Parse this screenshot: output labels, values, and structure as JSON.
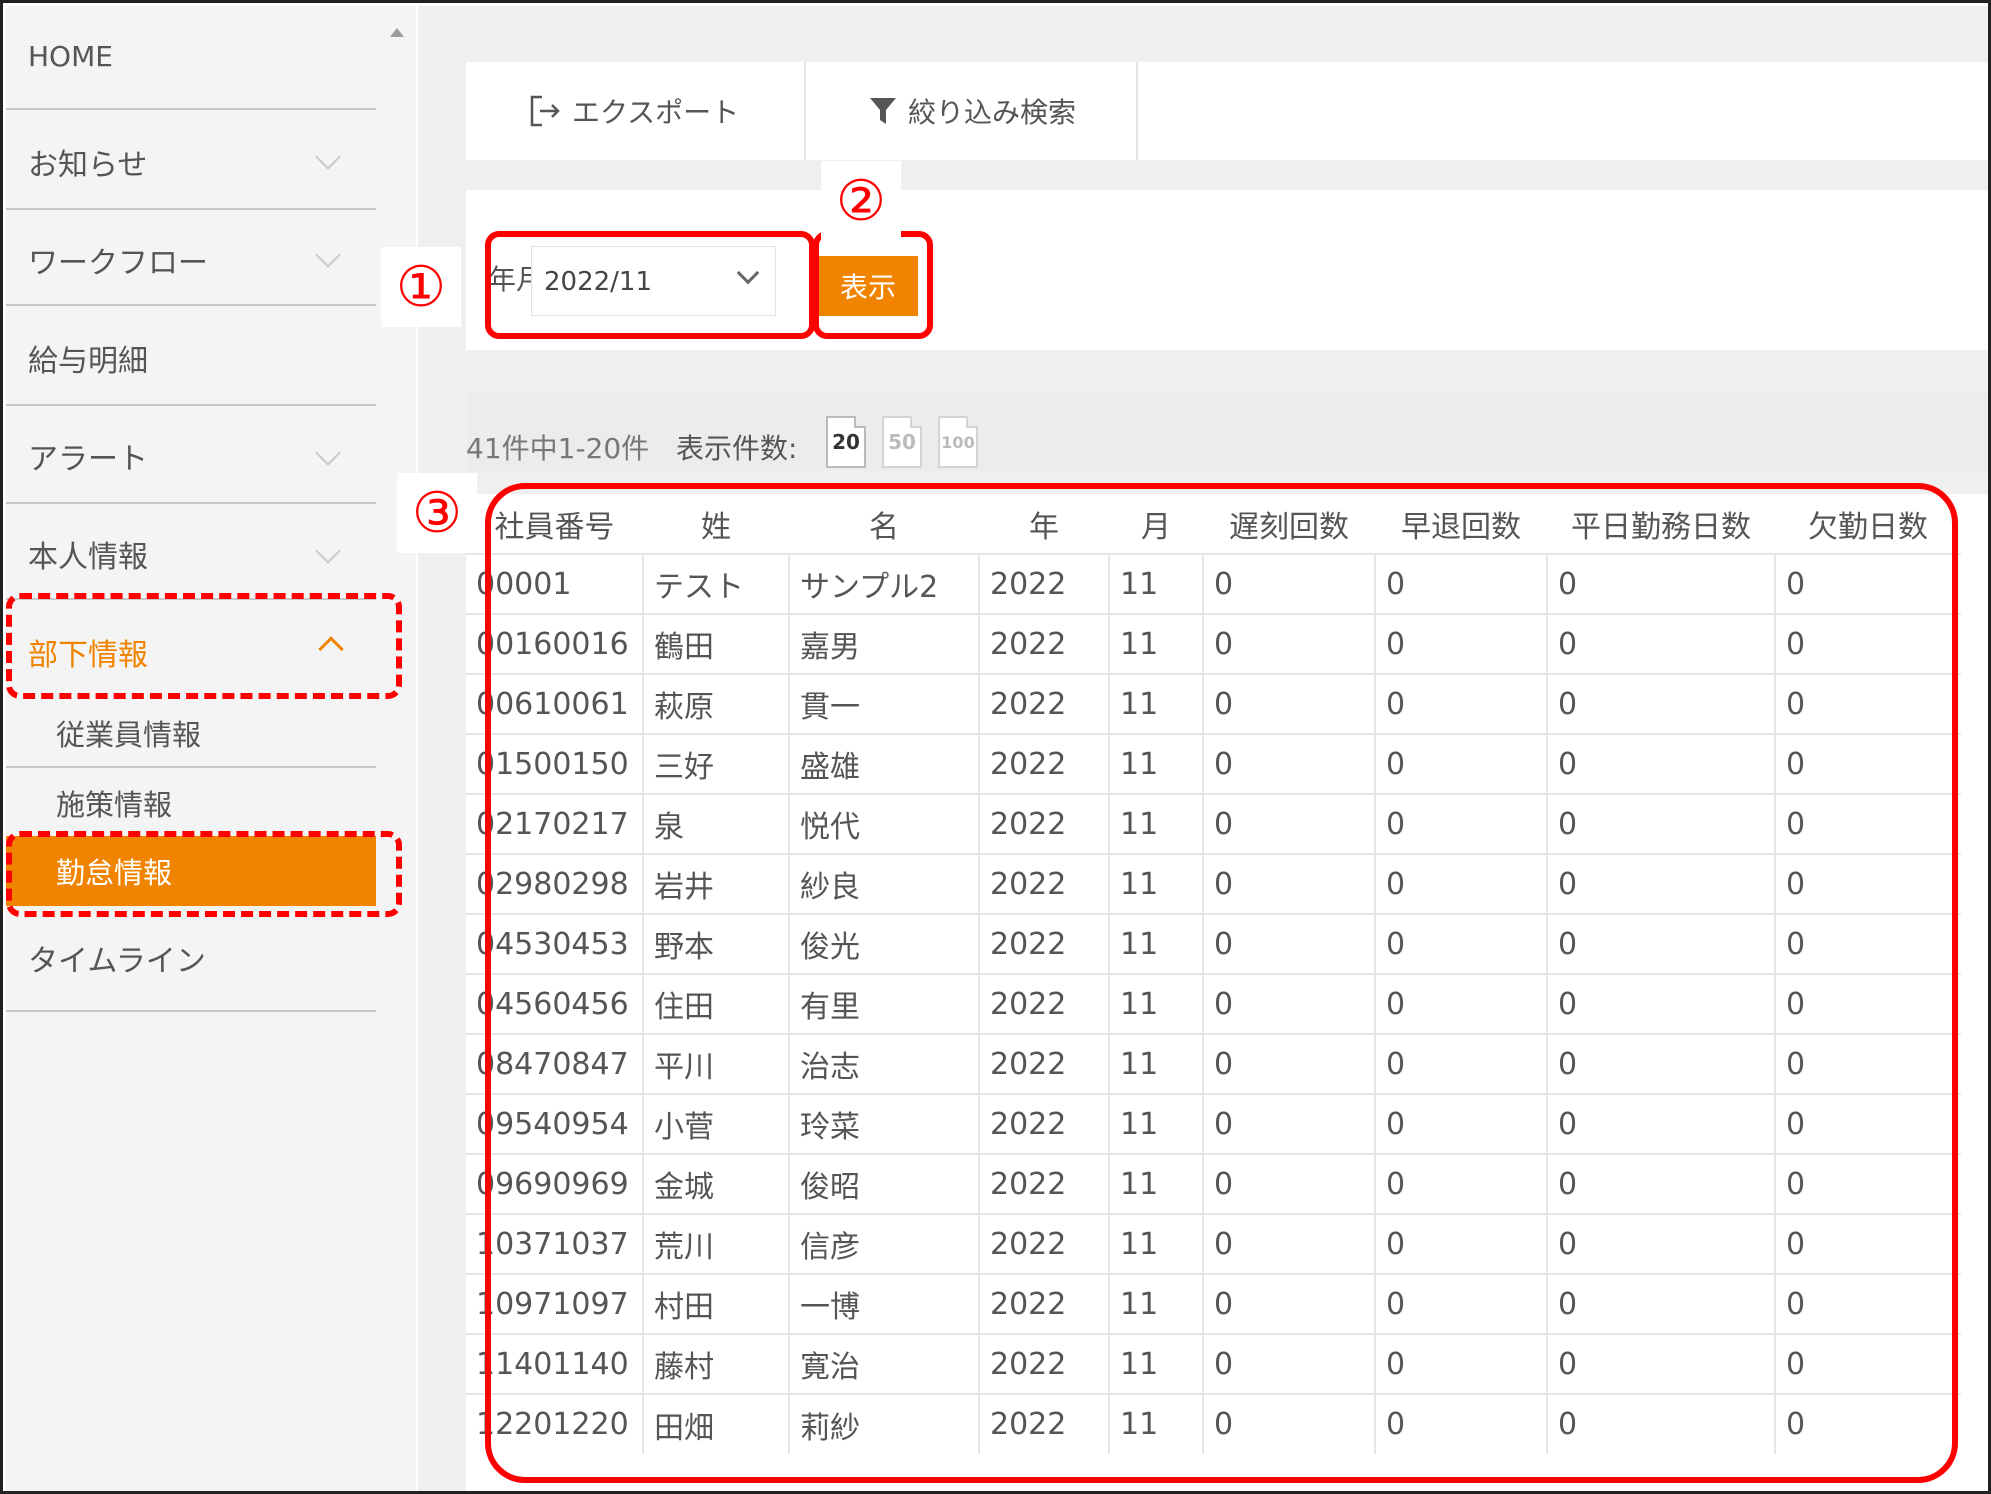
{
  "sidebar": {
    "items": [
      {
        "label": "HOME"
      },
      {
        "label": "お知らせ"
      },
      {
        "label": "ワークフロー"
      },
      {
        "label": "給与明細"
      },
      {
        "label": "アラート"
      },
      {
        "label": "本人情報"
      },
      {
        "label": "部下情報"
      },
      {
        "label": "タイムライン"
      }
    ],
    "subitems": [
      {
        "label": "従業員情報"
      },
      {
        "label": "施策情報"
      },
      {
        "label": "勤怠情報"
      }
    ]
  },
  "toolbar": {
    "export_label": "エクスポート",
    "filter_label": "絞り込み検索"
  },
  "filter": {
    "ym_label": "年月",
    "ym_value": "2022/11",
    "show_label": "表示"
  },
  "results": {
    "count_text": "41件中1-20件",
    "per_page_label": "表示件数:",
    "page_sizes": [
      "20",
      "50",
      "100"
    ],
    "pager_first": "|<<"
  },
  "table": {
    "headers": [
      "社員番号",
      "姓",
      "名",
      "年",
      "月",
      "遅刻回数",
      "早退回数",
      "平日勤務日数",
      "欠勤日数"
    ],
    "rows": [
      [
        "00001",
        "テスト",
        "サンプル2",
        "2022",
        "11",
        "0",
        "0",
        "0",
        "0"
      ],
      [
        "00160016",
        "鶴田",
        "嘉男",
        "2022",
        "11",
        "0",
        "0",
        "0",
        "0"
      ],
      [
        "00610061",
        "萩原",
        "貫一",
        "2022",
        "11",
        "0",
        "0",
        "0",
        "0"
      ],
      [
        "01500150",
        "三好",
        "盛雄",
        "2022",
        "11",
        "0",
        "0",
        "0",
        "0"
      ],
      [
        "02170217",
        "泉",
        "悦代",
        "2022",
        "11",
        "0",
        "0",
        "0",
        "0"
      ],
      [
        "02980298",
        "岩井",
        "紗良",
        "2022",
        "11",
        "0",
        "0",
        "0",
        "0"
      ],
      [
        "04530453",
        "野本",
        "俊光",
        "2022",
        "11",
        "0",
        "0",
        "0",
        "0"
      ],
      [
        "04560456",
        "住田",
        "有里",
        "2022",
        "11",
        "0",
        "0",
        "0",
        "0"
      ],
      [
        "08470847",
        "平川",
        "治志",
        "2022",
        "11",
        "0",
        "0",
        "0",
        "0"
      ],
      [
        "09540954",
        "小菅",
        "玲菜",
        "2022",
        "11",
        "0",
        "0",
        "0",
        "0"
      ],
      [
        "09690969",
        "金城",
        "俊昭",
        "2022",
        "11",
        "0",
        "0",
        "0",
        "0"
      ],
      [
        "10371037",
        "荒川",
        "信彦",
        "2022",
        "11",
        "0",
        "0",
        "0",
        "0"
      ],
      [
        "10971097",
        "村田",
        "一博",
        "2022",
        "11",
        "0",
        "0",
        "0",
        "0"
      ],
      [
        "11401140",
        "藤村",
        "寛治",
        "2022",
        "11",
        "0",
        "0",
        "0",
        "0"
      ],
      [
        "12201220",
        "田畑",
        "莉紗",
        "2022",
        "11",
        "0",
        "0",
        "0",
        "0"
      ]
    ]
  },
  "annotations": {
    "n1": "①",
    "n2": "②",
    "n3": "③"
  },
  "colors": {
    "accent": "#f08300",
    "annotation": "#ff0000"
  }
}
